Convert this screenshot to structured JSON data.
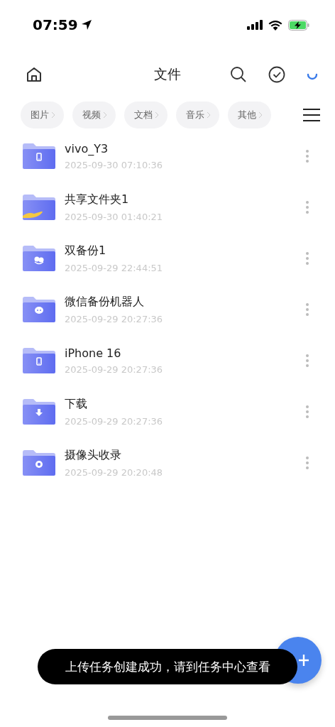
{
  "status_bar": {
    "time": "07:59"
  },
  "header": {
    "title": "文件"
  },
  "filters": [
    {
      "label": "图片"
    },
    {
      "label": "视频"
    },
    {
      "label": "文档"
    },
    {
      "label": "音乐"
    },
    {
      "label": "其他"
    }
  ],
  "files": [
    {
      "name": "vivo_Y3",
      "date": "2025-09-30 07:10:36",
      "kind": "phone"
    },
    {
      "name": "共享文件夹1",
      "date": "2025-09-30 01:40:21",
      "kind": "shared"
    },
    {
      "name": "双备份1",
      "date": "2025-09-29 22:44:51",
      "kind": "backup"
    },
    {
      "name": "微信备份机器人",
      "date": "2025-09-29 20:27:36",
      "kind": "chat"
    },
    {
      "name": "iPhone 16",
      "date": "2025-09-29 20:27:36",
      "kind": "phone"
    },
    {
      "name": "下载",
      "date": "2025-09-29 20:27:36",
      "kind": "download"
    },
    {
      "name": "摄像头收录",
      "date": "2025-09-29 20:20:48",
      "kind": "camera"
    }
  ],
  "toast": {
    "text": "上传任务创建成功，请到任务中心查看"
  }
}
